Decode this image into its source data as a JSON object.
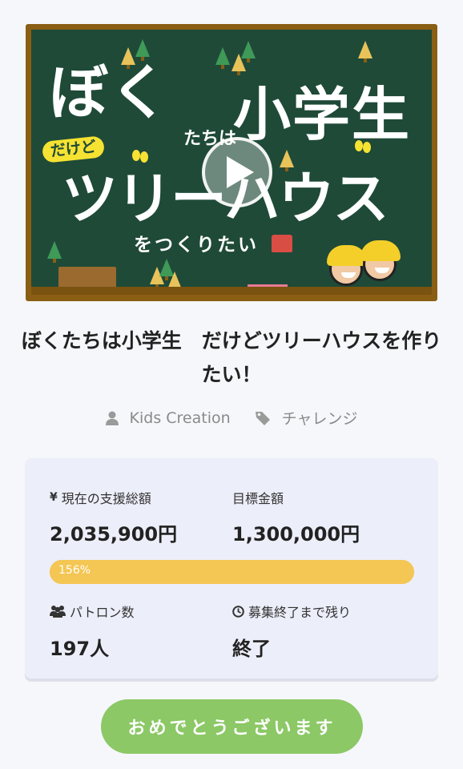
{
  "video": {
    "board_line1": "ぼく",
    "board_small": "たちは",
    "board_line1b": "小学生",
    "board_badge": "だけど",
    "board_line2": "ツリーハウス",
    "board_line3": "をつくりたい"
  },
  "project": {
    "title": "ぼくたちは小学生　だけどツリーハウスを作りたい！",
    "owner": "Kids Creation",
    "category": "チャレンジ"
  },
  "stats": {
    "current_label": "現在の支援総額",
    "current_value": "2,035,900円",
    "goal_label": "目標金額",
    "goal_value": "1,300,000円",
    "progress_text": "156%",
    "progress_fraction": 1.0,
    "patrons_label": "パトロン数",
    "patrons_value": "197人",
    "remaining_label": "募集終了まで残り",
    "remaining_value": "終了"
  },
  "cta": {
    "label": "おめでとうございます"
  },
  "colors": {
    "progress": "#f4c653",
    "cta": "#8cc866",
    "board": "#1f4a38",
    "frame": "#8a5f14"
  }
}
